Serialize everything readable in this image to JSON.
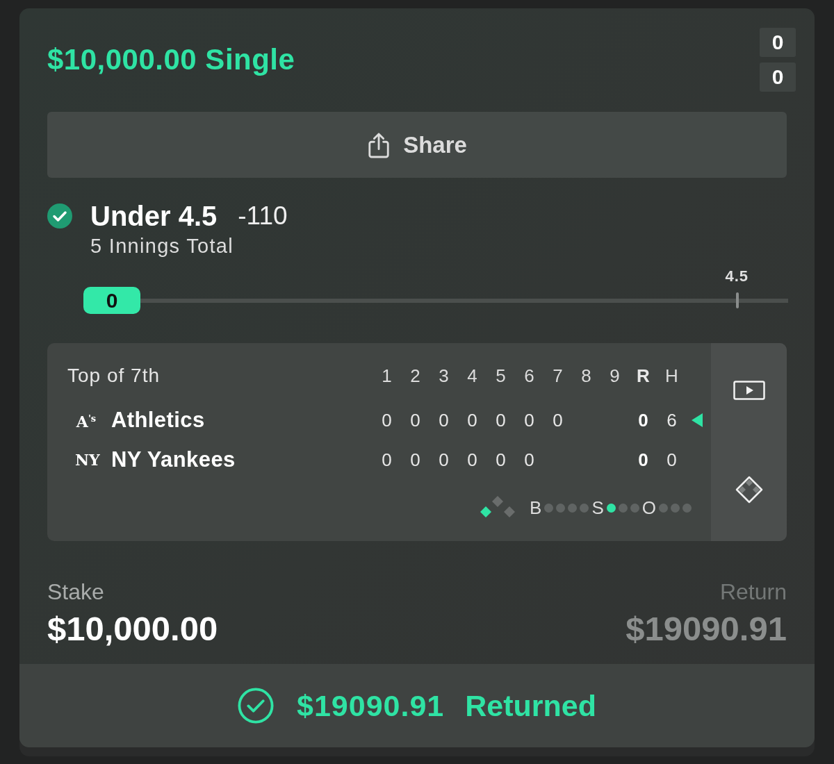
{
  "header": {
    "title": "$10,000.00 Single",
    "counters": [
      "0",
      "0"
    ]
  },
  "share_button": {
    "label": "Share"
  },
  "selection": {
    "pick": "Under 4.5",
    "odds": "-110",
    "market": "5 Innings Total"
  },
  "tracker": {
    "current": "0",
    "level": 0,
    "line": "4.5"
  },
  "scoreboard": {
    "status": "Top of 7th",
    "columns": [
      {
        "label": "1",
        "kind": "inning"
      },
      {
        "label": "2",
        "kind": "inning"
      },
      {
        "label": "3",
        "kind": "inning"
      },
      {
        "label": "4",
        "kind": "inning"
      },
      {
        "label": "5",
        "kind": "inning"
      },
      {
        "label": "6",
        "kind": "inning"
      },
      {
        "label": "7",
        "kind": "inning"
      },
      {
        "label": "8",
        "kind": "inning"
      },
      {
        "label": "9",
        "kind": "inning"
      },
      {
        "label": "R",
        "kind": "runs"
      },
      {
        "label": "H",
        "kind": "hits"
      }
    ],
    "teams": [
      {
        "logo": "A$^{'s}$",
        "name": "Athletics",
        "innings": [
          "0",
          "0",
          "0",
          "0",
          "0",
          "0",
          "0"
        ],
        "runs": "0",
        "hits": "6",
        "batting": true
      },
      {
        "logo": "NY",
        "name": "NY Yankees",
        "innings": [
          "0",
          "0",
          "0",
          "0",
          "0",
          "0"
        ],
        "runs": "0",
        "hits": "0",
        "batting": false
      }
    ],
    "bases": [
      {
        "occupied": false
      },
      {
        "occupied": false
      },
      {
        "occupied": true
      }
    ],
    "count": [
      {
        "label": "B",
        "lights": [
          {
            "on": false
          },
          {
            "on": false
          },
          {
            "on": false
          },
          {
            "on": false
          }
        ]
      },
      {
        "label": "S",
        "lights": [
          {
            "on": true
          },
          {
            "on": false
          },
          {
            "on": false
          }
        ]
      },
      {
        "label": "O",
        "lights": [
          {
            "on": false
          },
          {
            "on": false
          },
          {
            "on": false
          }
        ]
      }
    ]
  },
  "stake": {
    "label": "Stake",
    "amount": "$10,000.00"
  },
  "potential_return": {
    "label": "Return",
    "amount": "$19090.91"
  },
  "result": {
    "amount": "$19090.91",
    "label": "Returned"
  }
}
